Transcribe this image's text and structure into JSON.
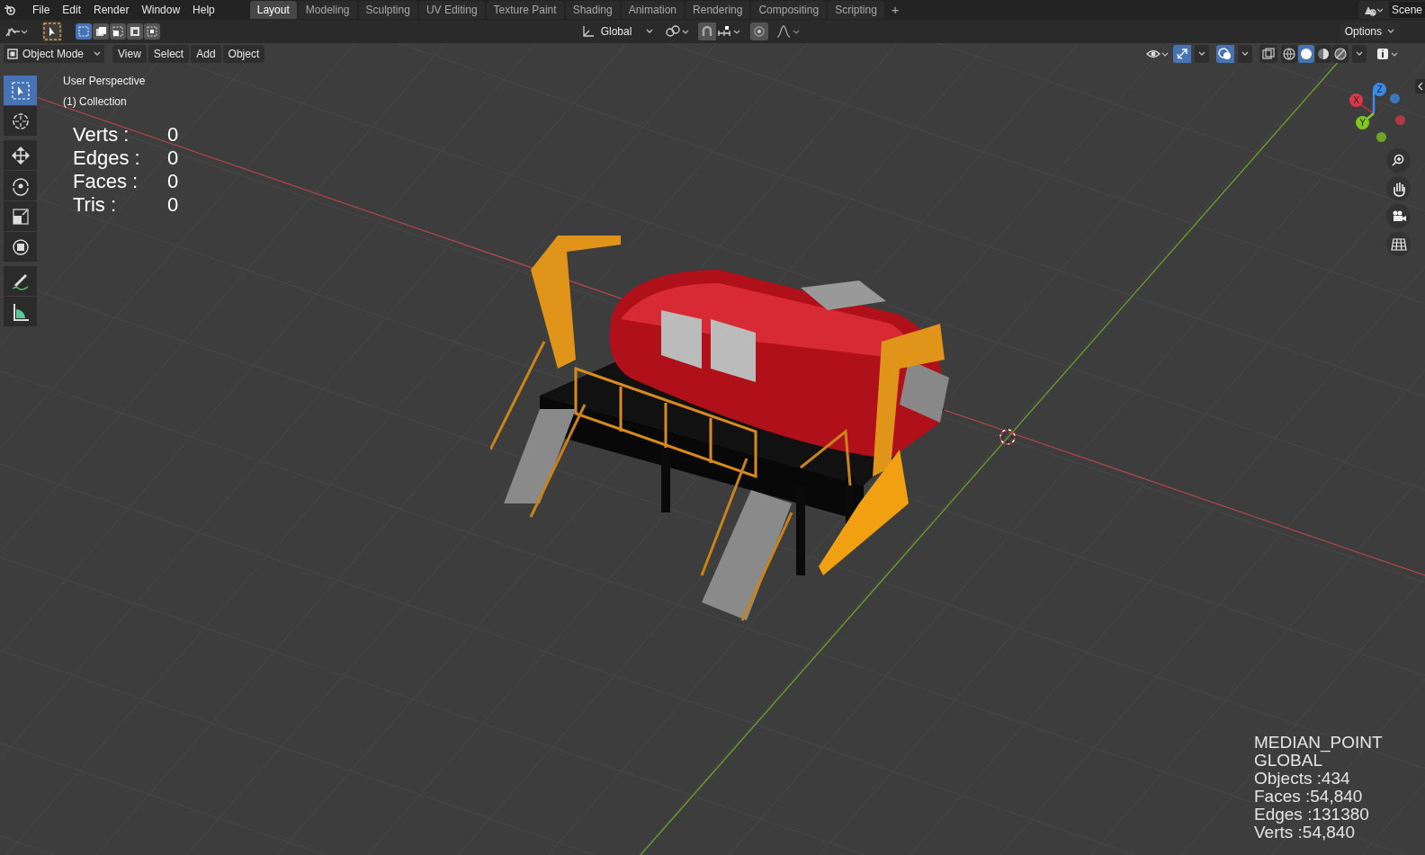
{
  "menu_bar": {
    "items": [
      "File",
      "Edit",
      "Render",
      "Window",
      "Help"
    ],
    "workspaces": [
      {
        "label": "Layout",
        "selected": true
      },
      {
        "label": "Modeling",
        "selected": false
      },
      {
        "label": "Sculpting",
        "selected": false
      },
      {
        "label": "UV Editing",
        "selected": false
      },
      {
        "label": "Texture Paint",
        "selected": false
      },
      {
        "label": "Shading",
        "selected": false
      },
      {
        "label": "Animation",
        "selected": false
      },
      {
        "label": "Rendering",
        "selected": false
      },
      {
        "label": "Compositing",
        "selected": false
      },
      {
        "label": "Scripting",
        "selected": false
      }
    ],
    "add_tab": "+",
    "scene": "Scene"
  },
  "tool_header": {
    "select_modes": [
      {
        "selected": true
      },
      {
        "selected": false
      },
      {
        "selected": false
      },
      {
        "selected": false
      },
      {
        "selected": false
      }
    ],
    "orientation": "Global",
    "options": "Options"
  },
  "viewport_header": {
    "mode": "Object Mode",
    "menus": [
      "View",
      "Select",
      "Add",
      "Object"
    ],
    "shading": [
      {
        "kind": "wireframe",
        "selected": false
      },
      {
        "kind": "solid",
        "selected": true
      },
      {
        "kind": "material",
        "selected": false
      },
      {
        "kind": "rendered",
        "selected": false
      }
    ]
  },
  "toolbar": [
    {
      "kind": "select",
      "selected": true
    },
    {
      "kind": "cursor",
      "selected": false
    },
    {
      "kind": "move",
      "selected": false
    },
    {
      "kind": "rotate",
      "selected": false
    },
    {
      "kind": "scale",
      "selected": false
    },
    {
      "kind": "transform",
      "selected": false
    },
    {
      "kind": "annotate",
      "selected": false
    },
    {
      "kind": "measure",
      "selected": false
    }
  ],
  "viewport": {
    "view_name": "User Perspective",
    "collection": "(1) Collection",
    "stats": [
      {
        "label": "Verts :",
        "value": "0"
      },
      {
        "label": "Edges :",
        "value": "0"
      },
      {
        "label": "Faces :",
        "value": "0"
      },
      {
        "label": "Tris :",
        "value": "0"
      }
    ],
    "gizmo": [
      {
        "label": "X",
        "color": "#d9374b"
      },
      {
        "label": "Y",
        "color": "#80c81c"
      },
      {
        "label": "Z",
        "color": "#3b8be6"
      }
    ],
    "scene_info": [
      "MEDIAN_POINT",
      "GLOBAL",
      "Objects :434",
      "Faces :54,840",
      "Edges :131380",
      "Verts :54,840"
    ]
  }
}
